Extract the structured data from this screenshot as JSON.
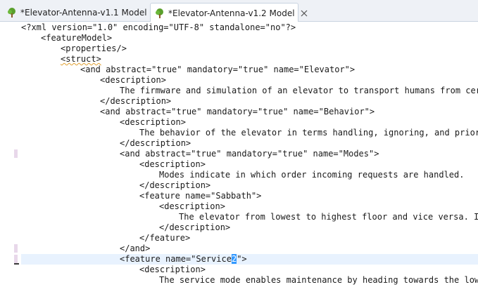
{
  "tabs": [
    {
      "label": "*Elevator-Antenna-v1.1 Model",
      "icon": "tree-icon",
      "active": false
    },
    {
      "label": "*Elevator-Antenna-v1.2 Model",
      "icon": "tree-icon",
      "active": true,
      "close_icon": "close-icon"
    }
  ],
  "editor": {
    "lines": [
      {
        "text": "<?xml version=\"1.0\" encoding=\"UTF-8\" standalone=\"no\"?>"
      },
      {
        "text": "<featureModel>"
      },
      {
        "text": "<properties/>"
      },
      {
        "text": "<struct>"
      },
      {
        "text": "<and abstract=\"true\" mandatory=\"true\" name=\"Elevator\">"
      },
      {
        "text": "<description>"
      },
      {
        "text": "The firmware and simulation of an elevator to transport humans from certa"
      },
      {
        "text": "</description>"
      },
      {
        "text": "<and abstract=\"true\" mandatory=\"true\" name=\"Behavior\">"
      },
      {
        "text": "<description>"
      },
      {
        "text": "The behavior of the elevator in terms handling, ignoring, and priorit"
      },
      {
        "text": "</description>"
      },
      {
        "text": "<and abstract=\"true\" mandatory=\"true\" name=\"Modes\">"
      },
      {
        "text": "<description>"
      },
      {
        "text": "Modes indicate in which order incoming requests are handled."
      },
      {
        "text": "</description>"
      },
      {
        "text": "<feature name=\"Sabbath\">"
      },
      {
        "text": "<description>"
      },
      {
        "text": "The elevator from lowest to highest floor and vice versa. It"
      },
      {
        "text": "</description>"
      },
      {
        "text": "</feature>"
      },
      {
        "text": "</and>"
      },
      {
        "text_before": "<feature name=\"Service",
        "text_selected": "2",
        "text_after": "\">"
      },
      {
        "text": "<description>"
      },
      {
        "text": "The service mode enables maintenance by heading towards the lowes"
      }
    ]
  }
}
